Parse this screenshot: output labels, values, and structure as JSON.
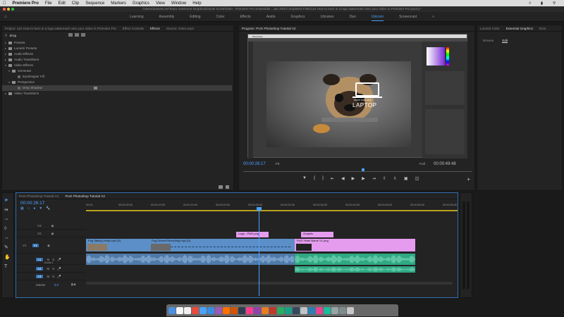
{
  "menubar": {
    "app": "Premiere Pro",
    "items": [
      "File",
      "Edit",
      "Clip",
      "Sequence",
      "Markers",
      "Graphics",
      "View",
      "Window",
      "Help"
    ],
    "clock": "Mon 9:41 AM"
  },
  "titlebar": {
    "path": "/Users/danielscott/Team Awesome Dropbox/Daniel Scott/Video - Premiere Pro Essentials - Jan 20/8 Completed Files/124 How to burn in a logo watermark onto your video in Premiere Pro.prproj *"
  },
  "workspaces": {
    "items": [
      "Learning",
      "Assembly",
      "Editing",
      "Color",
      "Effects",
      "Audio",
      "Graphics",
      "Libraries",
      "Dan",
      "Unicorn",
      "Screencast"
    ],
    "active": "Unicorn"
  },
  "effects_panel": {
    "tabs": [
      "Project: 124 How to burn in a logo watermark onto your video in Premiere Pro",
      "Effect Controls",
      "Effects",
      "Source: Outro.mp3"
    ],
    "active_tab": "Effects",
    "search_value": "drop",
    "tree": [
      {
        "label": "Presets",
        "level": 0
      },
      {
        "label": "Lumetri Presets",
        "level": 0
      },
      {
        "label": "Audio Effects",
        "level": 0
      },
      {
        "label": "Audio Transitions",
        "level": 0
      },
      {
        "label": "Video Effects",
        "level": 0,
        "open": true
      },
      {
        "label": "Generate",
        "level": 1,
        "open": true
      },
      {
        "label": "Eyedropper Fill",
        "level": 2,
        "item": true
      },
      {
        "label": "Perspective",
        "level": 1,
        "open": true
      },
      {
        "label": "Drop Shadow",
        "level": 2,
        "item": true,
        "selected": true
      },
      {
        "label": "Video Transitions",
        "level": 0
      }
    ]
  },
  "program": {
    "title": "Program: PUG Photoshop Tutorial V2",
    "ps_title": "Photoshop",
    "logo_text": "LAPTOP",
    "logo_subtext": "BRAND NAME HERE",
    "timecode": "00:00:26:17",
    "fit": "Fit",
    "quality": "Full",
    "duration": "00:00:49:48"
  },
  "essential": {
    "tabs": [
      "Lumetri Color",
      "Essential Graphics",
      "Eros"
    ],
    "active_tab": "Essential Graphics",
    "subtabs": [
      "Browse",
      "Edit"
    ],
    "active_subtab": "Edit"
  },
  "timeline": {
    "tabs": [
      "PUG Photoshop Tutorial V1",
      "PUG Photoshop Tutorial V2"
    ],
    "active_tab": "PUG Photoshop Tutorial V2",
    "timecode": "00:00:26:17",
    "ruler": [
      "00:00",
      "00:00:05:00",
      "00:00:10:00",
      "00:00:15:00",
      "00:00:20:00",
      "00:00:25:00",
      "00:00:30:00",
      "00:00:35:00",
      "00:00:40:00",
      "00:00:45:00",
      "00:00:50:00",
      "00:00:55:00"
    ],
    "tracks": [
      {
        "name": "V3",
        "type": "video"
      },
      {
        "name": "V2",
        "type": "video"
      },
      {
        "name": "V1",
        "type": "video",
        "active": true
      },
      {
        "name": "A1",
        "type": "audio",
        "label": "Audio 1"
      },
      {
        "name": "A2",
        "type": "audio"
      },
      {
        "name": "A3",
        "type": "audio"
      },
      {
        "name": "Master",
        "type": "master",
        "value": "0.0"
      }
    ],
    "clips": {
      "logo": "Logo - PNG.png",
      "graphic": "Graphic",
      "talking": "Pug Talking Head.mp4 [V]",
      "screen": "Pug Screen Recording.mp4 [V]",
      "name": "PUG Hotel Name V1.png"
    }
  },
  "dock": {
    "count": 24
  },
  "colors": {
    "accent": "#4aa3ff",
    "video_clip": "#5c8fc8",
    "graphic_clip": "#e59cee",
    "audio_blue": "#4f7aa8",
    "audio_green": "#2fa883"
  }
}
